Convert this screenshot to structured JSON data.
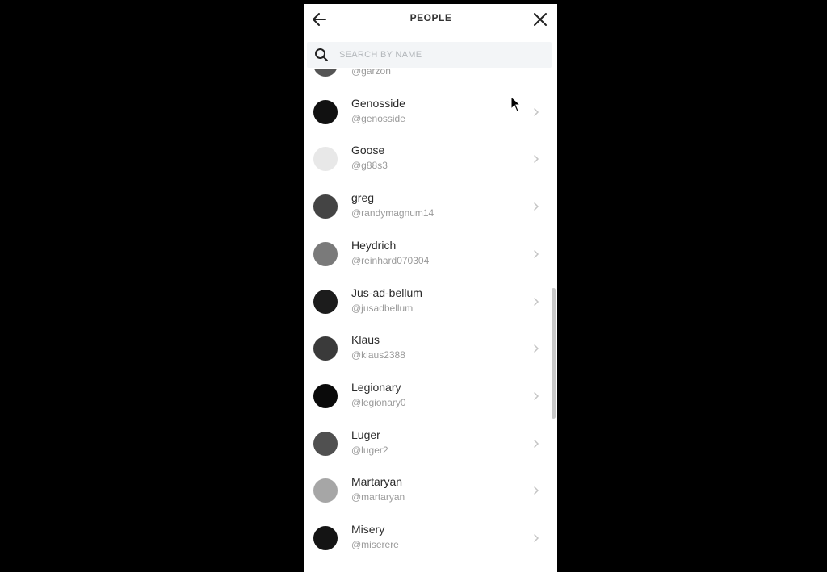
{
  "header": {
    "title": "PEOPLE",
    "back_icon": "arrow-left-icon",
    "close_icon": "close-icon"
  },
  "search": {
    "placeholder": "SEARCH BY NAME",
    "value": "",
    "icon": "search-icon"
  },
  "people": [
    {
      "name": "",
      "handle": "@garzon",
      "avatar_tone": "#555555"
    },
    {
      "name": "Genosside",
      "handle": "@genosside",
      "avatar_tone": "#111111"
    },
    {
      "name": "Goose",
      "handle": "@g88s3",
      "avatar_tone": "#e8e8e8"
    },
    {
      "name": "greg",
      "handle": "@randymagnum14",
      "avatar_tone": "#444444"
    },
    {
      "name": "Heydrich",
      "handle": "@reinhard070304",
      "avatar_tone": "#7a7a7a"
    },
    {
      "name": "Jus-ad-bellum",
      "handle": "@jusadbellum",
      "avatar_tone": "#1c1c1c"
    },
    {
      "name": "Klaus",
      "handle": "@klaus2388",
      "avatar_tone": "#3a3a3a"
    },
    {
      "name": "Legionary",
      "handle": "@legionary0",
      "avatar_tone": "#0a0a0a"
    },
    {
      "name": "Luger",
      "handle": "@luger2",
      "avatar_tone": "#505050"
    },
    {
      "name": "Martaryan",
      "handle": "@martaryan",
      "avatar_tone": "#a6a6a6"
    },
    {
      "name": "Misery",
      "handle": "@miserere",
      "avatar_tone": "#141414"
    }
  ],
  "colors": {
    "background": "#000000",
    "panel": "#ffffff",
    "search_bg": "#f3f5f7",
    "name_text": "#2b2b2b",
    "handle_text": "#9a9a9a",
    "chevron": "#c4c4c4"
  }
}
